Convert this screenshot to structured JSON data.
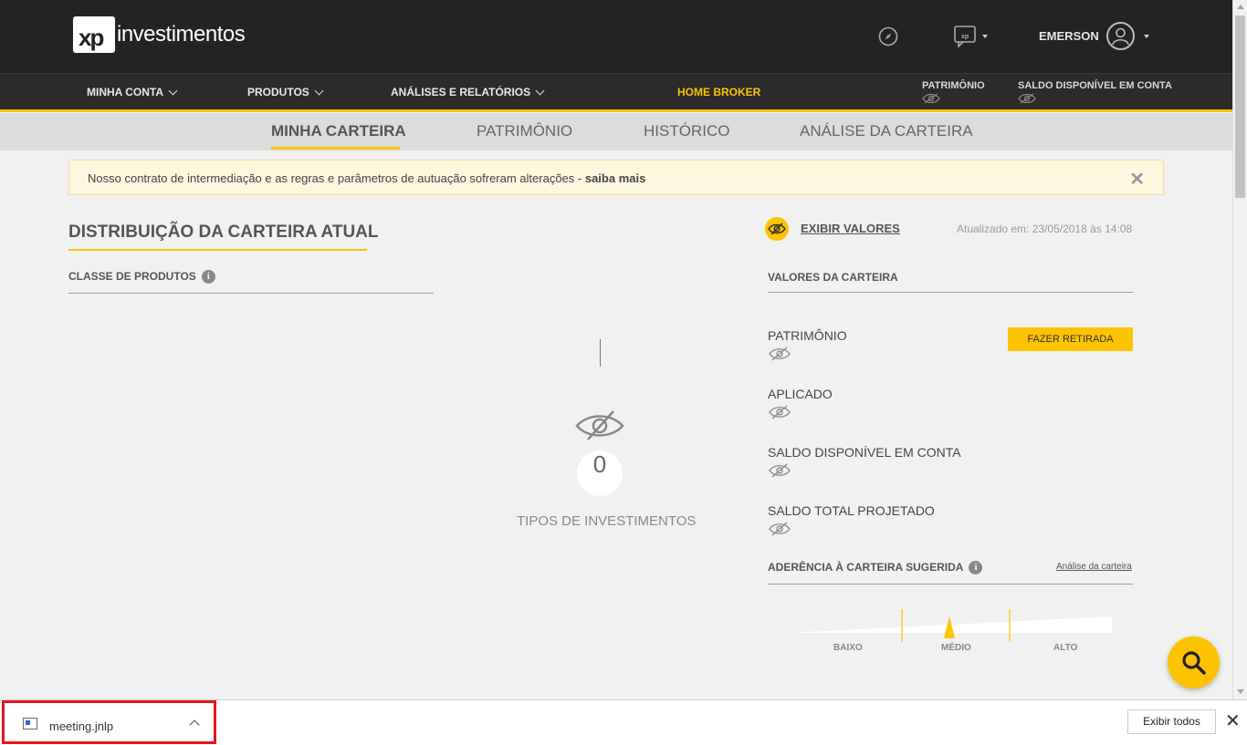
{
  "header": {
    "logo_mark": "xp",
    "logo_word": "investimentos",
    "user_name": "EMERSON"
  },
  "nav": {
    "items": [
      "MINHA CONTA",
      "PRODUTOS",
      "ANÁLISES E RELATÓRIOS"
    ],
    "home_broker": "HOME BROKER",
    "patrimonio": "PATRIMÔNIO",
    "saldo": "SALDO DISPONÍVEL EM CONTA"
  },
  "tabs": [
    "MINHA CARTEIRA",
    "PATRIMÔNIO",
    "HISTÓRICO",
    "ANÁLISE DA CARTEIRA"
  ],
  "notice": {
    "text": "Nosso contrato de intermediação e as regras e parâmetros de autuação sofreram alterações - ",
    "link": "saiba mais",
    "close": "✕"
  },
  "left": {
    "title": "DISTRIBUIÇÃO DA CARTEIRA ATUAL",
    "classe_label": "CLASSE DE PRODUTOS",
    "count": "0",
    "count_label": "TIPOS DE INVESTIMENTOS"
  },
  "right": {
    "exibir": "EXIBIR VALORES",
    "updated": "Atualizado em: 23/05/2018 às 14:08",
    "valores_head": "VALORES DA CARTEIRA",
    "rows": [
      "PATRIMÔNIO",
      "APLICADO",
      "SALDO DISPONÍVEL EM CONTA",
      "SALDO TOTAL PROJETADO"
    ],
    "retirada_btn": "FAZER RETIRADA",
    "aderencia": "ADERÊNCIA À CARTEIRA SUGERIDA",
    "analise_link": "Análise da carteira",
    "gauge_labels": [
      "BAIXO",
      "MÉDIO",
      "ALTO"
    ]
  },
  "colors": {
    "accent": "#fdc300",
    "header_bg": "#232323"
  },
  "download_bar": {
    "file_name": "meeting.jnlp",
    "show_all": "Exibir todos"
  }
}
